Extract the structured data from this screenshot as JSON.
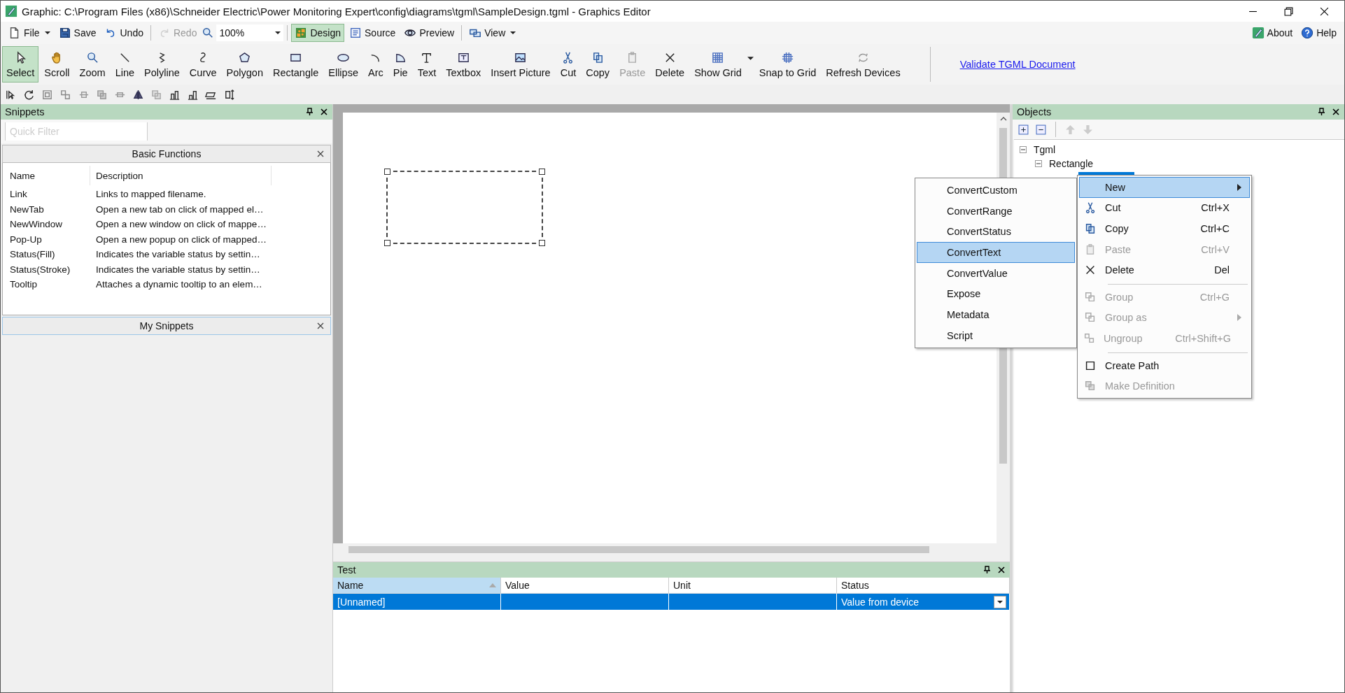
{
  "window": {
    "title": "Graphic: C:\\Program Files (x86)\\Schneider Electric\\Power Monitoring Expert\\config\\diagrams\\tgml\\SampleDesign.tgml - Graphics Editor"
  },
  "menu_bar": {
    "items": [
      {
        "label": "File",
        "kind": "dropdown",
        "disabled": false,
        "selected": false
      },
      {
        "label": "Save",
        "kind": "button",
        "disabled": false,
        "selected": false
      },
      {
        "label": "Undo",
        "kind": "button",
        "disabled": false,
        "selected": false
      },
      {
        "label": "Redo",
        "kind": "button",
        "disabled": true,
        "selected": false
      },
      {
        "label": "Design",
        "kind": "button",
        "disabled": false,
        "selected": true
      },
      {
        "label": "Source",
        "kind": "button",
        "disabled": false,
        "selected": false
      },
      {
        "label": "Preview",
        "kind": "button",
        "disabled": false,
        "selected": false
      },
      {
        "label": "View",
        "kind": "dropdown",
        "disabled": false,
        "selected": false
      }
    ],
    "zoom": "100%",
    "right": [
      "About",
      "Help"
    ]
  },
  "tools": [
    {
      "label": "Select",
      "selected": true,
      "disabled": false
    },
    {
      "label": "Scroll",
      "selected": false,
      "disabled": false
    },
    {
      "label": "Zoom",
      "selected": false,
      "disabled": false
    },
    {
      "label": "Line",
      "selected": false,
      "disabled": false
    },
    {
      "label": "Polyline",
      "selected": false,
      "disabled": false
    },
    {
      "label": "Curve",
      "selected": false,
      "disabled": false
    },
    {
      "label": "Polygon",
      "selected": false,
      "disabled": false
    },
    {
      "label": "Rectangle",
      "selected": false,
      "disabled": false
    },
    {
      "label": "Ellipse",
      "selected": false,
      "disabled": false
    },
    {
      "label": "Arc",
      "selected": false,
      "disabled": false
    },
    {
      "label": "Pie",
      "selected": false,
      "disabled": false
    },
    {
      "label": "Text",
      "selected": false,
      "disabled": false
    },
    {
      "label": "Textbox",
      "selected": false,
      "disabled": false
    },
    {
      "label": "Insert Picture",
      "selected": false,
      "disabled": false
    },
    {
      "label": "Cut",
      "selected": false,
      "disabled": false
    },
    {
      "label": "Copy",
      "selected": false,
      "disabled": false
    },
    {
      "label": "Paste",
      "selected": false,
      "disabled": true
    },
    {
      "label": "Delete",
      "selected": false,
      "disabled": false
    },
    {
      "label": "Show Grid",
      "selected": false,
      "disabled": false
    },
    {
      "label": "Snap to Grid",
      "selected": false,
      "disabled": false
    },
    {
      "label": "Refresh Devices",
      "selected": false,
      "disabled": false
    }
  ],
  "validate_link": "Validate TGML Document",
  "snippets": {
    "title": "Snippets",
    "filter_placeholder": "Quick Filter",
    "basic_functions": {
      "title": "Basic Functions",
      "columns": [
        "Name",
        "Description"
      ],
      "rows": [
        {
          "name": "Link",
          "description": "Links to mapped filename."
        },
        {
          "name": "NewTab",
          "description": "Open a new tab on click of mapped el…"
        },
        {
          "name": "NewWindow",
          "description": "Open a new window on click of mappe…"
        },
        {
          "name": "Pop-Up",
          "description": "Open a new popup on click of mapped…"
        },
        {
          "name": "Status(Fill)",
          "description": "Indicates the variable status by settin…"
        },
        {
          "name": "Status(Stroke)",
          "description": "Indicates the variable status by settin…"
        },
        {
          "name": "Tooltip",
          "description": "Attaches a dynamic tooltip to an elem…"
        }
      ]
    },
    "my_snippets": {
      "title": "My Snippets"
    }
  },
  "objects": {
    "title": "Objects",
    "tree": [
      {
        "label": "Tgml",
        "expanded": true,
        "children": [
          {
            "label": "Rectangle",
            "expanded": true
          }
        ]
      }
    ]
  },
  "context_menu": {
    "items": [
      {
        "label": "New",
        "selected": true,
        "disabled": false,
        "submenu": true,
        "separator_before": false
      },
      {
        "label": "Cut",
        "shortcut": "Ctrl+X",
        "selected": false,
        "disabled": false,
        "submenu": false,
        "separator_before": false
      },
      {
        "label": "Copy",
        "shortcut": "Ctrl+C",
        "selected": false,
        "disabled": false,
        "submenu": false,
        "separator_before": false
      },
      {
        "label": "Paste",
        "shortcut": "Ctrl+V",
        "selected": false,
        "disabled": true,
        "submenu": false,
        "separator_before": false
      },
      {
        "label": "Delete",
        "shortcut": "Del",
        "selected": false,
        "disabled": false,
        "submenu": false,
        "separator_before": false
      },
      {
        "label": "Group",
        "shortcut": "Ctrl+G",
        "selected": false,
        "disabled": true,
        "submenu": false,
        "separator_before": true
      },
      {
        "label": "Group as",
        "selected": false,
        "disabled": true,
        "submenu": true,
        "separator_before": false
      },
      {
        "label": "Ungroup",
        "shortcut": "Ctrl+Shift+G",
        "selected": false,
        "disabled": true,
        "submenu": false,
        "separator_before": false
      },
      {
        "label": "Create Path",
        "selected": false,
        "disabled": false,
        "submenu": false,
        "separator_before": true
      },
      {
        "label": "Make Definition",
        "selected": false,
        "disabled": true,
        "submenu": false,
        "separator_before": false
      }
    ]
  },
  "submenu": {
    "items": [
      {
        "label": "ConvertCustom",
        "selected": false
      },
      {
        "label": "ConvertRange",
        "selected": false
      },
      {
        "label": "ConvertStatus",
        "selected": false
      },
      {
        "label": "ConvertText",
        "selected": true
      },
      {
        "label": "ConvertValue",
        "selected": false
      },
      {
        "label": "Expose",
        "selected": false
      },
      {
        "label": "Metadata",
        "selected": false
      },
      {
        "label": "Script",
        "selected": false
      }
    ]
  },
  "test": {
    "title": "Test",
    "columns": [
      "Name",
      "Value",
      "Unit",
      "Status"
    ],
    "rows": [
      {
        "name": "[Unnamed]",
        "value": "",
        "unit": "",
        "status": "Value from device",
        "selected": true
      }
    ]
  }
}
